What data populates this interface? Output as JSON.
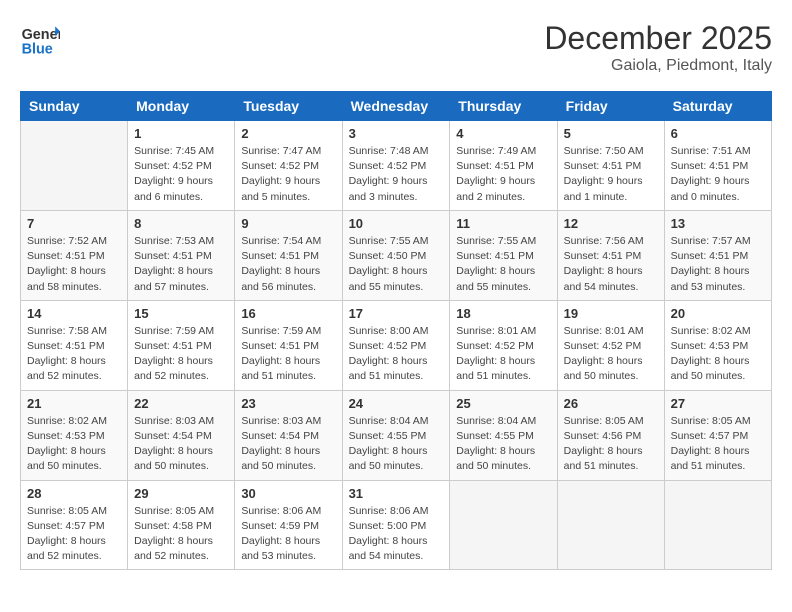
{
  "header": {
    "logo_line1": "General",
    "logo_line2": "Blue",
    "title": "December 2025",
    "subtitle": "Gaiola, Piedmont, Italy"
  },
  "calendar": {
    "days_of_week": [
      "Sunday",
      "Monday",
      "Tuesday",
      "Wednesday",
      "Thursday",
      "Friday",
      "Saturday"
    ],
    "weeks": [
      [
        {
          "day": "",
          "info": ""
        },
        {
          "day": "1",
          "info": "Sunrise: 7:45 AM\nSunset: 4:52 PM\nDaylight: 9 hours\nand 6 minutes."
        },
        {
          "day": "2",
          "info": "Sunrise: 7:47 AM\nSunset: 4:52 PM\nDaylight: 9 hours\nand 5 minutes."
        },
        {
          "day": "3",
          "info": "Sunrise: 7:48 AM\nSunset: 4:52 PM\nDaylight: 9 hours\nand 3 minutes."
        },
        {
          "day": "4",
          "info": "Sunrise: 7:49 AM\nSunset: 4:51 PM\nDaylight: 9 hours\nand 2 minutes."
        },
        {
          "day": "5",
          "info": "Sunrise: 7:50 AM\nSunset: 4:51 PM\nDaylight: 9 hours\nand 1 minute."
        },
        {
          "day": "6",
          "info": "Sunrise: 7:51 AM\nSunset: 4:51 PM\nDaylight: 9 hours\nand 0 minutes."
        }
      ],
      [
        {
          "day": "7",
          "info": "Sunrise: 7:52 AM\nSunset: 4:51 PM\nDaylight: 8 hours\nand 58 minutes."
        },
        {
          "day": "8",
          "info": "Sunrise: 7:53 AM\nSunset: 4:51 PM\nDaylight: 8 hours\nand 57 minutes."
        },
        {
          "day": "9",
          "info": "Sunrise: 7:54 AM\nSunset: 4:51 PM\nDaylight: 8 hours\nand 56 minutes."
        },
        {
          "day": "10",
          "info": "Sunrise: 7:55 AM\nSunset: 4:50 PM\nDaylight: 8 hours\nand 55 minutes."
        },
        {
          "day": "11",
          "info": "Sunrise: 7:55 AM\nSunset: 4:51 PM\nDaylight: 8 hours\nand 55 minutes."
        },
        {
          "day": "12",
          "info": "Sunrise: 7:56 AM\nSunset: 4:51 PM\nDaylight: 8 hours\nand 54 minutes."
        },
        {
          "day": "13",
          "info": "Sunrise: 7:57 AM\nSunset: 4:51 PM\nDaylight: 8 hours\nand 53 minutes."
        }
      ],
      [
        {
          "day": "14",
          "info": "Sunrise: 7:58 AM\nSunset: 4:51 PM\nDaylight: 8 hours\nand 52 minutes."
        },
        {
          "day": "15",
          "info": "Sunrise: 7:59 AM\nSunset: 4:51 PM\nDaylight: 8 hours\nand 52 minutes."
        },
        {
          "day": "16",
          "info": "Sunrise: 7:59 AM\nSunset: 4:51 PM\nDaylight: 8 hours\nand 51 minutes."
        },
        {
          "day": "17",
          "info": "Sunrise: 8:00 AM\nSunset: 4:52 PM\nDaylight: 8 hours\nand 51 minutes."
        },
        {
          "day": "18",
          "info": "Sunrise: 8:01 AM\nSunset: 4:52 PM\nDaylight: 8 hours\nand 51 minutes."
        },
        {
          "day": "19",
          "info": "Sunrise: 8:01 AM\nSunset: 4:52 PM\nDaylight: 8 hours\nand 50 minutes."
        },
        {
          "day": "20",
          "info": "Sunrise: 8:02 AM\nSunset: 4:53 PM\nDaylight: 8 hours\nand 50 minutes."
        }
      ],
      [
        {
          "day": "21",
          "info": "Sunrise: 8:02 AM\nSunset: 4:53 PM\nDaylight: 8 hours\nand 50 minutes."
        },
        {
          "day": "22",
          "info": "Sunrise: 8:03 AM\nSunset: 4:54 PM\nDaylight: 8 hours\nand 50 minutes."
        },
        {
          "day": "23",
          "info": "Sunrise: 8:03 AM\nSunset: 4:54 PM\nDaylight: 8 hours\nand 50 minutes."
        },
        {
          "day": "24",
          "info": "Sunrise: 8:04 AM\nSunset: 4:55 PM\nDaylight: 8 hours\nand 50 minutes."
        },
        {
          "day": "25",
          "info": "Sunrise: 8:04 AM\nSunset: 4:55 PM\nDaylight: 8 hours\nand 50 minutes."
        },
        {
          "day": "26",
          "info": "Sunrise: 8:05 AM\nSunset: 4:56 PM\nDaylight: 8 hours\nand 51 minutes."
        },
        {
          "day": "27",
          "info": "Sunrise: 8:05 AM\nSunset: 4:57 PM\nDaylight: 8 hours\nand 51 minutes."
        }
      ],
      [
        {
          "day": "28",
          "info": "Sunrise: 8:05 AM\nSunset: 4:57 PM\nDaylight: 8 hours\nand 52 minutes."
        },
        {
          "day": "29",
          "info": "Sunrise: 8:05 AM\nSunset: 4:58 PM\nDaylight: 8 hours\nand 52 minutes."
        },
        {
          "day": "30",
          "info": "Sunrise: 8:06 AM\nSunset: 4:59 PM\nDaylight: 8 hours\nand 53 minutes."
        },
        {
          "day": "31",
          "info": "Sunrise: 8:06 AM\nSunset: 5:00 PM\nDaylight: 8 hours\nand 54 minutes."
        },
        {
          "day": "",
          "info": ""
        },
        {
          "day": "",
          "info": ""
        },
        {
          "day": "",
          "info": ""
        }
      ]
    ]
  }
}
